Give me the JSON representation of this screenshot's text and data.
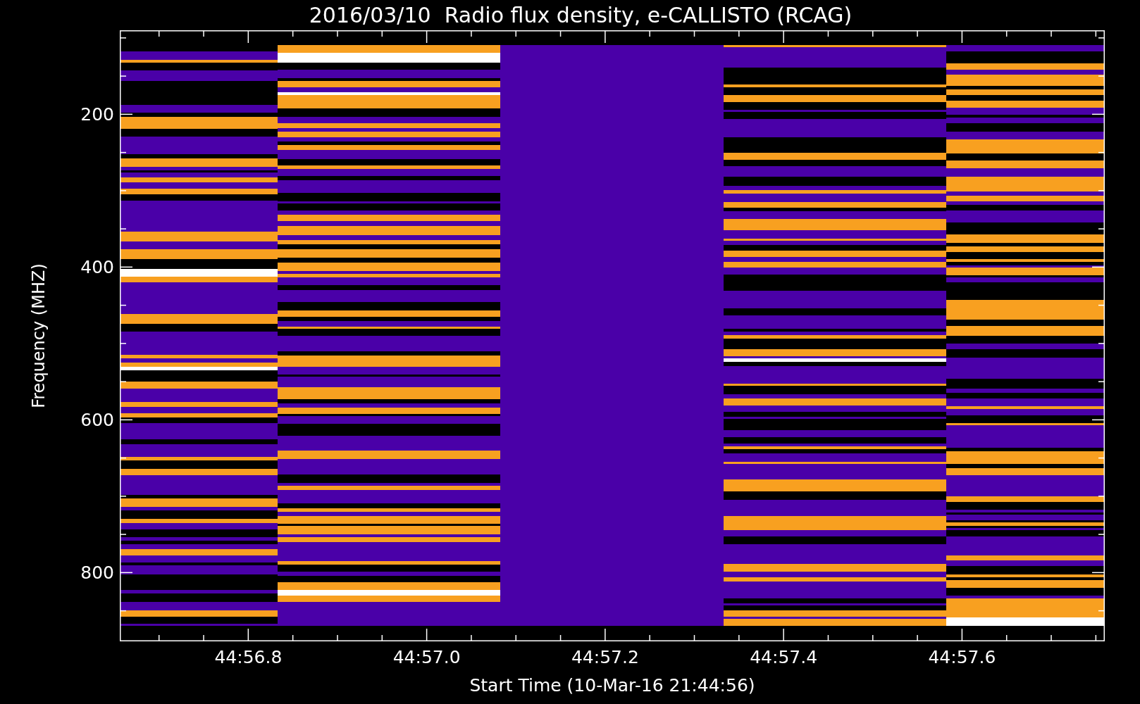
{
  "title": "2016/03/10  Radio flux density, e-CALLISTO (RCAG)",
  "y_axis": {
    "label": "Frequency (MHZ)",
    "ticks": [
      "200",
      "400",
      "600",
      "800"
    ]
  },
  "x_axis": {
    "label": "Start Time (10-Mar-16 21:44:56)",
    "ticks": [
      "44:56.8",
      "44:57.0",
      "44:57.2",
      "44:57.4",
      "44:57.6"
    ]
  }
}
